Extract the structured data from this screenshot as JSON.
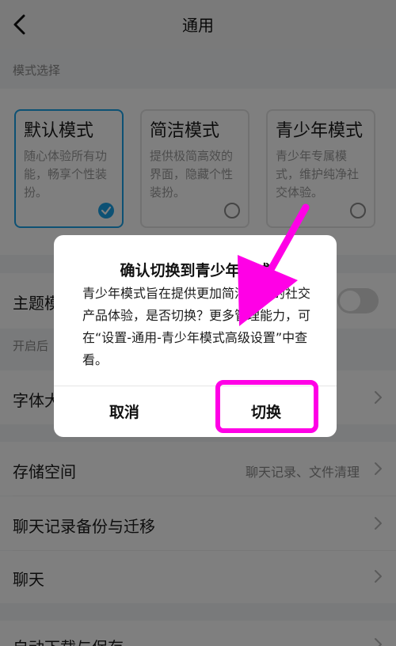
{
  "header": {
    "title": "通用"
  },
  "mode_section": {
    "label": "模式选择",
    "cards": [
      {
        "name": "默认模式",
        "desc": "随心体验所有功能，畅享个性装扮。",
        "selected": true
      },
      {
        "name": "简洁模式",
        "desc": "提供极简高效的界面，隐藏个性装扮。",
        "selected": false
      },
      {
        "name": "青少年模式",
        "desc": "青少年专属模式，维护纯净社交体验。",
        "selected": false
      }
    ]
  },
  "theme": {
    "label": "主题模式",
    "hint": "开启后"
  },
  "font_size": {
    "label": "字体大小"
  },
  "storage": {
    "label": "存储空间",
    "value": "聊天记录、文件清理"
  },
  "backup": {
    "label": "聊天记录备份与迁移"
  },
  "chat": {
    "label": "聊天"
  },
  "auto_download": {
    "label": "自动下载与保存"
  },
  "dialog": {
    "title": "确认切换到青少年模式",
    "body": "青少年模式旨在提供更加简洁清净的社交产品体验，是否切换？更多管理能力，可在“设置-通用-青少年模式高级设置”中查看。",
    "cancel": "取消",
    "confirm": "切换"
  },
  "colors": {
    "accent": "#1aa3e8",
    "annotation": "#ff00e6"
  }
}
